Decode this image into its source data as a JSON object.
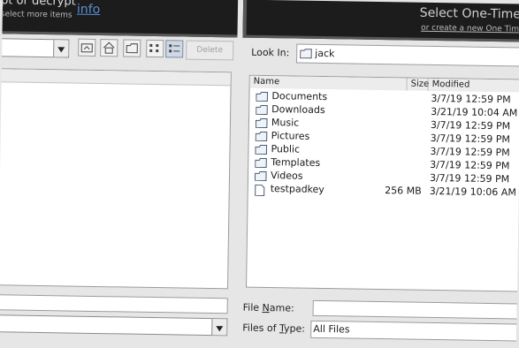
{
  "header": {
    "left_title": "pt or decrypt",
    "left_subtitle": "select more items",
    "info_link": "info",
    "right_title": "Select One-Time",
    "right_link": "or create a new One Time"
  },
  "left_dialog": {
    "toolbar": {
      "delete_label": "Delete"
    }
  },
  "right_dialog": {
    "look_in_label": "Look In:",
    "look_in_value": "jack",
    "columns": {
      "name": "Name",
      "size": "Size",
      "modified": "Modified"
    },
    "files": [
      {
        "name": "Documents",
        "size": "",
        "modified": "3/7/19 12:59 PM",
        "type": "folder"
      },
      {
        "name": "Downloads",
        "size": "",
        "modified": "3/21/19 10:04 AM",
        "type": "folder"
      },
      {
        "name": "Music",
        "size": "",
        "modified": "3/7/19 12:59 PM",
        "type": "folder"
      },
      {
        "name": "Pictures",
        "size": "",
        "modified": "3/7/19 12:59 PM",
        "type": "folder"
      },
      {
        "name": "Public",
        "size": "",
        "modified": "3/7/19 12:59 PM",
        "type": "folder"
      },
      {
        "name": "Templates",
        "size": "",
        "modified": "3/7/19 12:59 PM",
        "type": "folder"
      },
      {
        "name": "Videos",
        "size": "",
        "modified": "3/7/19 12:59 PM",
        "type": "folder"
      },
      {
        "name": "testpadkey",
        "size": "256 MB",
        "modified": "3/21/19 10:06 AM",
        "type": "file"
      }
    ],
    "file_name_label": "File Name:",
    "file_name_value": "",
    "files_of_type_label": "Files of Type:",
    "files_of_type_value": "All Files"
  }
}
